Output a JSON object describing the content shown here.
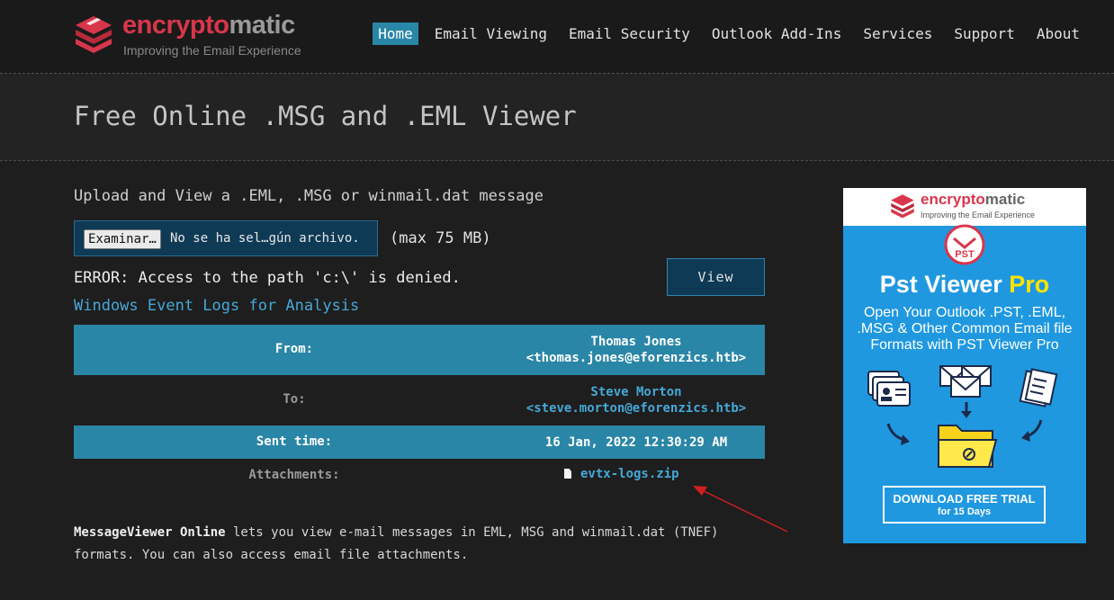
{
  "brand": {
    "name_part1": "encrypto",
    "name_part2": "matic",
    "tagline": "Improving the Email Experience",
    "primary_color": "#d9364b"
  },
  "nav": {
    "items": [
      {
        "label": "Home",
        "active": true
      },
      {
        "label": "Email Viewing"
      },
      {
        "label": "Email Security"
      },
      {
        "label": "Outlook Add-Ins"
      },
      {
        "label": "Services"
      },
      {
        "label": "Support"
      },
      {
        "label": "About"
      }
    ],
    "active_color": "#2a86a6"
  },
  "page": {
    "title": "Free Online .MSG and .EML Viewer"
  },
  "upload": {
    "heading": "Upload and View a .EML, .MSG or winmail.dat message",
    "browse_label": "Examinar…",
    "file_status": "No se ha sel…gún archivo.",
    "max_note": "(max 75 MB)",
    "view_label": "View"
  },
  "error": {
    "message": "ERROR: Access to the path 'c:\\' is denied."
  },
  "message": {
    "subject": "Windows Event Logs for Analysis",
    "from_label": "From:",
    "from_name": "Thomas Jones",
    "from_email": "<thomas.jones@eforenzics.htb>",
    "to_label": "To:",
    "to_name": "Steve Morton",
    "to_email": "<steve.morton@eforenzics.htb>",
    "sent_label": "Sent time:",
    "sent_value": "16 Jan, 2022 12:30:29 AM",
    "attachments_label": "Attachments:",
    "attachment_name": "evtx-logs.zip",
    "attachment_icon": "document-icon"
  },
  "footer": {
    "bold": "MessageViewer Online",
    "text": " lets you view e-mail messages in EML, MSG and winmail.dat (TNEF) formats. You can also access email file attachments."
  },
  "ad": {
    "brand_part1": "encrypto",
    "brand_part2": "matic",
    "brand_tagline": "Improving the Email Experience",
    "badge_text": "PST",
    "title_main": "Pst Viewer ",
    "title_accent": "Pro",
    "description": "Open Your Outlook .PST, .EML, .MSG & Other Common Email file Formats with PST Viewer Pro",
    "cta_line1": "DOWNLOAD FREE TRIAL",
    "cta_line2": "for 15 Days",
    "background": "#1f98e0",
    "accent": "#ffe300"
  },
  "annotation": {
    "arrow_color": "#d21e1e"
  }
}
